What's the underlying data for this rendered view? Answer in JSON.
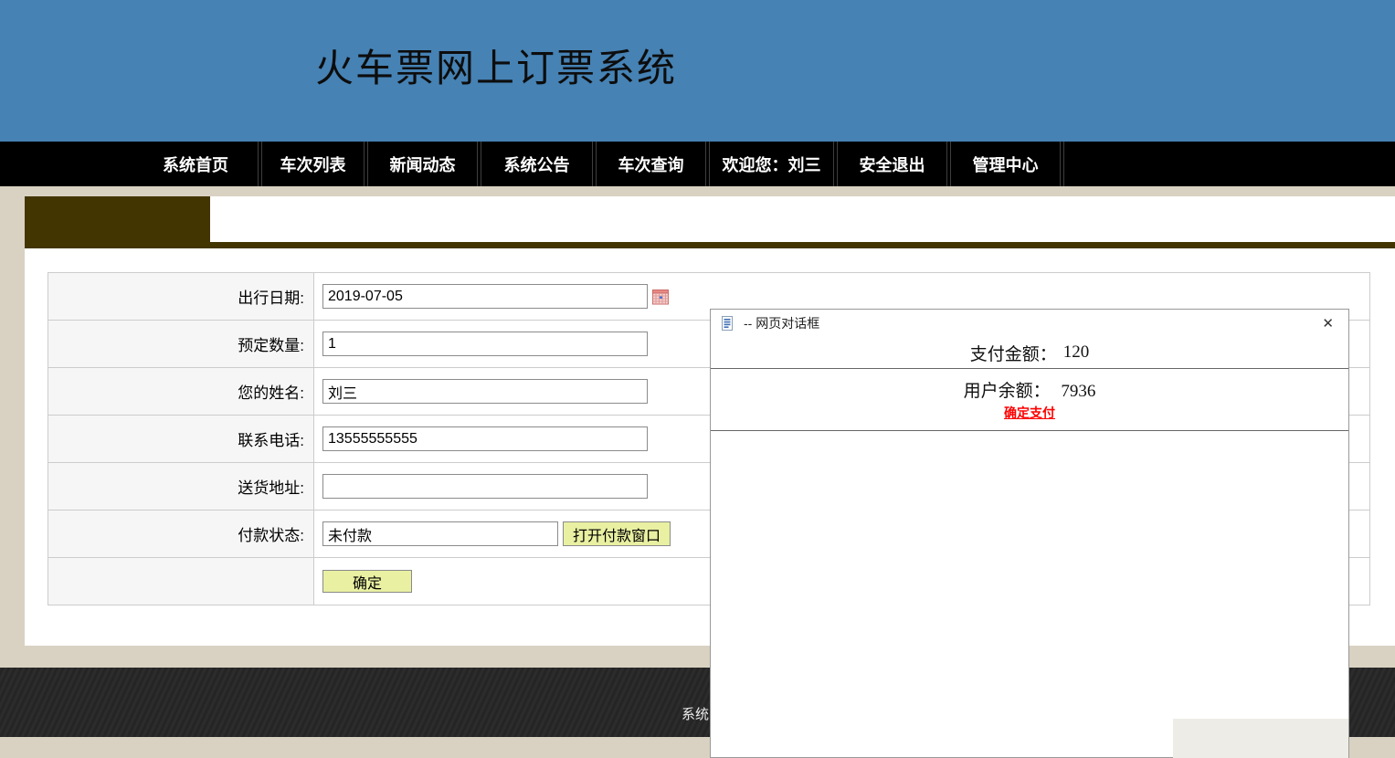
{
  "header": {
    "title": "火车票网上订票系统"
  },
  "nav": {
    "items": [
      {
        "label": "系统首页"
      },
      {
        "label": "车次列表"
      },
      {
        "label": "新闻动态"
      },
      {
        "label": "系统公告"
      },
      {
        "label": "车次查询"
      },
      {
        "label": "欢迎您：刘三"
      },
      {
        "label": "安全退出"
      },
      {
        "label": "管理中心"
      }
    ]
  },
  "form": {
    "rows": [
      {
        "label": "出行日期:",
        "value": "2019-07-05"
      },
      {
        "label": "预定数量:",
        "value": "1"
      },
      {
        "label": "您的姓名:",
        "value": "刘三"
      },
      {
        "label": "联系电话:",
        "value": "13555555555"
      },
      {
        "label": "送货地址:",
        "value": ""
      },
      {
        "label": "付款状态:",
        "value": "未付款",
        "button_label": "打开付款窗口"
      }
    ],
    "submit_label": "确定"
  },
  "dialog": {
    "title": "-- 网页对话框",
    "close_glyph": "✕",
    "payment_label": "支付金额：",
    "payment_value": "120",
    "balance_label": "用户余额：",
    "balance_value": "7936",
    "confirm_link": "确定支付"
  },
  "footer": {
    "visible_text": "系统"
  },
  "colors": {
    "header_blue": "#4682b4",
    "nav_black": "#000000",
    "tab_brown": "#423502",
    "button_bg": "#e9f0a2",
    "link_red": "#ff0000",
    "page_beige": "#d9d2c2",
    "label_cell_bg": "#f6f6f6"
  }
}
